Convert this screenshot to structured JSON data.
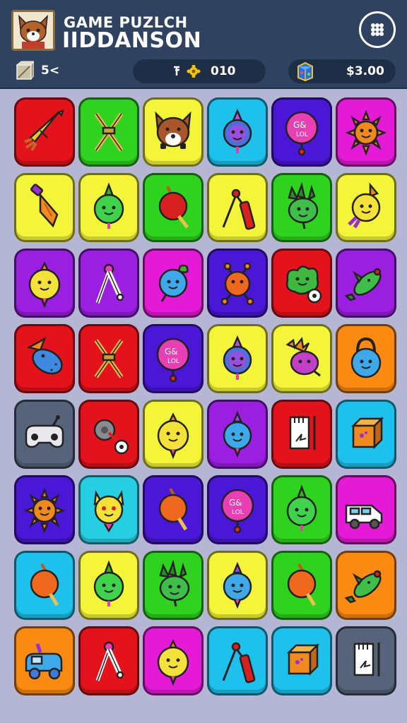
{
  "header": {
    "title_line1": "GAME PUZLCH",
    "title_line2": "IIDDANSON",
    "moves": "5<",
    "score": "010",
    "money": "$3.00"
  },
  "colors": {
    "red": "#e3121b",
    "green": "#2fd21f",
    "yellow": "#f4f43a",
    "cyan": "#1ec0ec",
    "blue": "#4a17d6",
    "magenta": "#e51ad6",
    "purple": "#9a1fe0",
    "orange": "#fb8a12",
    "teal": "#27cde0",
    "gray": "#56637a"
  },
  "board": [
    [
      {
        "bg": "red",
        "icon": "rocket-icon"
      },
      {
        "bg": "green",
        "icon": "crossed-sticks-icon"
      },
      {
        "bg": "yellow",
        "icon": "fox-face-icon"
      },
      {
        "bg": "cyan",
        "icon": "purple-fruit-icon"
      },
      {
        "bg": "blue",
        "icon": "candy-ball-icon"
      },
      {
        "bg": "magenta",
        "icon": "sun-face-icon"
      }
    ],
    [
      {
        "bg": "yellow",
        "icon": "arrow-drill-icon"
      },
      {
        "bg": "yellow",
        "icon": "green-fruit-icon"
      },
      {
        "bg": "green",
        "icon": "red-lollipop-icon"
      },
      {
        "bg": "yellow",
        "icon": "firecracker-icon"
      },
      {
        "bg": "green",
        "icon": "green-creature-icon"
      },
      {
        "bg": "yellow",
        "icon": "yellow-rocket-face-icon"
      }
    ],
    [
      {
        "bg": "purple",
        "icon": "yellow-face-icon"
      },
      {
        "bg": "purple",
        "icon": "compass-icon"
      },
      {
        "bg": "magenta",
        "icon": "blue-leaf-fruit-icon"
      },
      {
        "bg": "blue",
        "icon": "orange-bug-icon"
      },
      {
        "bg": "red",
        "icon": "green-blob-icon"
      },
      {
        "bg": "purple",
        "icon": "green-fish-icon"
      }
    ],
    [
      {
        "bg": "red",
        "icon": "blue-fish-icon"
      },
      {
        "bg": "red",
        "icon": "crossed-sticks-icon"
      },
      {
        "bg": "blue",
        "icon": "candy-ball-icon"
      },
      {
        "bg": "yellow",
        "icon": "purple-fruit-icon"
      },
      {
        "bg": "yellow",
        "icon": "purple-berry-icon"
      },
      {
        "bg": "orange",
        "icon": "blue-kettlebell-icon"
      }
    ],
    [
      {
        "bg": "gray",
        "icon": "gamepad-icon"
      },
      {
        "bg": "red",
        "icon": "pizza-cutter-icon"
      },
      {
        "bg": "yellow",
        "icon": "yellow-face-icon"
      },
      {
        "bg": "purple",
        "icon": "blue-face-icon"
      },
      {
        "bg": "red",
        "icon": "book-icon"
      },
      {
        "bg": "cyan",
        "icon": "orange-box-icon"
      }
    ],
    [
      {
        "bg": "blue",
        "icon": "sun-face-icon"
      },
      {
        "bg": "teal",
        "icon": "yellow-cat-icon"
      },
      {
        "bg": "blue",
        "icon": "orange-lollipop-icon"
      },
      {
        "bg": "blue",
        "icon": "candy-ball-icon"
      },
      {
        "bg": "green",
        "icon": "green-fruit-icon"
      },
      {
        "bg": "magenta",
        "icon": "van-icon"
      }
    ],
    [
      {
        "bg": "cyan",
        "icon": "orange-lollipop-icon"
      },
      {
        "bg": "yellow",
        "icon": "green-fruit-icon"
      },
      {
        "bg": "green",
        "icon": "green-creature-icon"
      },
      {
        "bg": "yellow",
        "icon": "blue-face-icon"
      },
      {
        "bg": "green",
        "icon": "orange-lollipop-icon"
      },
      {
        "bg": "orange",
        "icon": "green-fish-icon"
      }
    ],
    [
      {
        "bg": "orange",
        "icon": "blue-car-icon"
      },
      {
        "bg": "red",
        "icon": "compass-icon"
      },
      {
        "bg": "magenta",
        "icon": "yellow-face-icon"
      },
      {
        "bg": "cyan",
        "icon": "firecracker-icon"
      },
      {
        "bg": "cyan",
        "icon": "orange-box-icon"
      },
      {
        "bg": "gray",
        "icon": "book-icon"
      }
    ]
  ]
}
